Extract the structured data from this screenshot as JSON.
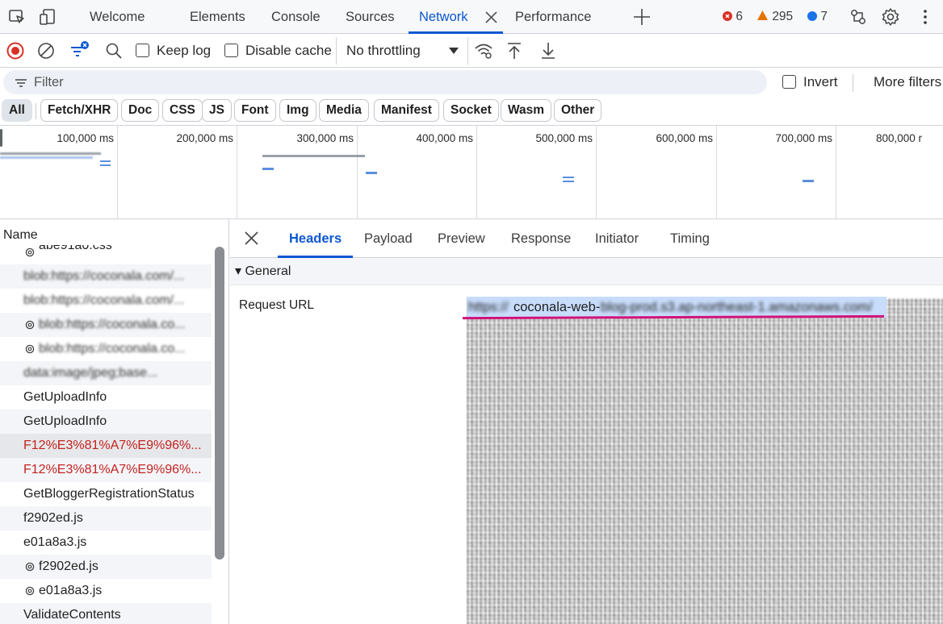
{
  "tabbar": {
    "tabs": [
      {
        "id": "welcome",
        "label": "Welcome"
      },
      {
        "id": "elements",
        "label": "Elements"
      },
      {
        "id": "console",
        "label": "Console"
      },
      {
        "id": "sources",
        "label": "Sources"
      },
      {
        "id": "network",
        "label": "Network",
        "active": true
      },
      {
        "id": "performance",
        "label": "Performance"
      }
    ],
    "errors": "6",
    "warnings": "295",
    "messages": "7",
    "colors": {
      "error": "#d93025",
      "warning": "#e37400",
      "info": "#1a73e8",
      "accent": "#0b57d0"
    }
  },
  "toolbar": {
    "keep_log": "Keep log",
    "disable_cache": "Disable cache",
    "throttling": "No throttling"
  },
  "filter": {
    "placeholder": "Filter",
    "invert": "Invert",
    "more_filters": "More filters"
  },
  "types": [
    "All",
    "Fetch/XHR",
    "Doc",
    "CSS",
    "JS",
    "Font",
    "Img",
    "Media",
    "Manifest",
    "Socket",
    "Wasm",
    "Other"
  ],
  "overview": {
    "ticks": [
      "100,000 ms",
      "200,000 ms",
      "300,000 ms",
      "400,000 ms",
      "500,000 ms",
      "600,000 ms",
      "700,000 ms",
      "800,000 r"
    ]
  },
  "requests": {
    "column_header": "Name",
    "rows": [
      {
        "name": "abe91a0.css",
        "gear": true
      },
      {
        "name": "blob:https://coconala.com/...",
        "blurred": true
      },
      {
        "name": "blob:https://coconala.com/...",
        "blurred": true
      },
      {
        "name": "blob:https://coconala.co...",
        "blurred": true,
        "gear": true
      },
      {
        "name": "blob:https://coconala.co...",
        "blurred": true,
        "gear": true
      },
      {
        "name": "data:image/jpeg;base...",
        "blurred": true
      },
      {
        "name": "GetUploadInfo"
      },
      {
        "name": "GetUploadInfo"
      },
      {
        "name": "F12%E3%81%A7%E9%96%...",
        "error": true,
        "selected": true
      },
      {
        "name": "F12%E3%81%A7%E9%96%...",
        "error": true
      },
      {
        "name": "GetBloggerRegistrationStatus"
      },
      {
        "name": "f2902ed.js"
      },
      {
        "name": "e01a8a3.js"
      },
      {
        "name": "f2902ed.js",
        "gear": true
      },
      {
        "name": "e01a8a3.js",
        "gear": true
      },
      {
        "name": "ValidateContents"
      }
    ]
  },
  "detail": {
    "tabs": [
      "Headers",
      "Payload",
      "Preview",
      "Response",
      "Initiator",
      "Timing"
    ],
    "active_tab": "Headers",
    "section": "▾ General",
    "request_url_label": "Request URL",
    "request_url_prefix": "https://",
    "request_url_visible": "coconala-web-",
    "request_url_rest": "blog-prod.s3.ap-northeast-1.amazonaws.com/"
  }
}
